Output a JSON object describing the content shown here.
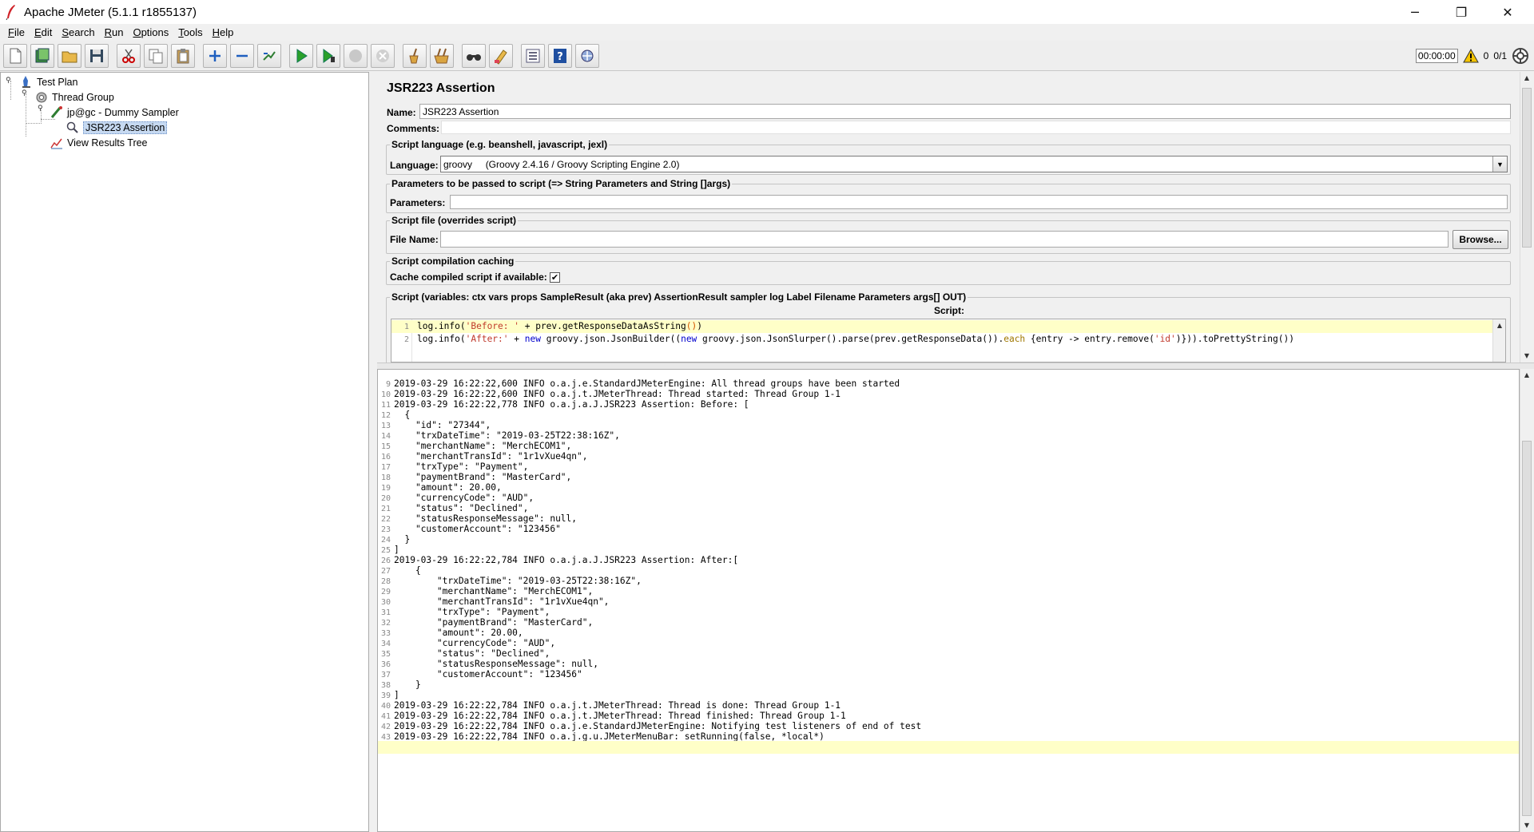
{
  "window": {
    "title": "Apache JMeter (5.1.1 r1855137)",
    "controls": {
      "minimize": "─",
      "maximize": "❐",
      "close": "✕"
    }
  },
  "menu": [
    "File",
    "Edit",
    "Search",
    "Run",
    "Options",
    "Tools",
    "Help"
  ],
  "toolbar": {
    "buttons": [
      "new-icon",
      "templates-icon",
      "open-icon",
      "save-icon",
      "cut-icon",
      "copy-icon",
      "paste-icon",
      "expand-icon",
      "collapse-icon",
      "toggle-icon",
      "start-icon",
      "start-no-pause-icon",
      "stop-icon",
      "shutdown-icon",
      "clear-icon",
      "clear-all-icon",
      "search-icon",
      "reset-search-icon",
      "function-helper-icon",
      "help-icon",
      "remote-icon"
    ],
    "timer": "00:00:00",
    "warning_count": "0",
    "threads": "0/1"
  },
  "tree": {
    "items": [
      {
        "label": "Test Plan",
        "icon": "test-plan-icon"
      },
      {
        "label": "Thread Group",
        "icon": "thread-group-icon"
      },
      {
        "label": "jp@gc - Dummy Sampler",
        "icon": "sampler-icon"
      },
      {
        "label": "JSR223 Assertion",
        "icon": "assertion-icon"
      },
      {
        "label": "View Results Tree",
        "icon": "listener-icon"
      }
    ]
  },
  "form": {
    "title": "JSR223 Assertion",
    "name_label": "Name:",
    "name_value": "JSR223 Assertion",
    "comments_label": "Comments:",
    "comments_value": "",
    "script_language_legend": "Script language (e.g. beanshell, javascript, jexl)",
    "language_label": "Language:",
    "language_value": "groovy     (Groovy 2.4.16 / Groovy Scripting Engine 2.0)",
    "parameters_legend": "Parameters to be passed to script (=> String Parameters and String []args)",
    "parameters_label": "Parameters:",
    "parameters_value": "",
    "script_file_legend": "Script file (overrides script)",
    "file_name_label": "File Name:",
    "file_name_value": "",
    "browse_label": "Browse...",
    "caching_legend": "Script compilation caching",
    "cache_label": "Cache compiled script if available:",
    "cache_checked": "✔",
    "script_legend": "Script (variables: ctx vars props SampleResult (aka prev) AssertionResult sampler log Label Filename Parameters args[] OUT)",
    "script_label": "Script:"
  },
  "script_lines": [
    {
      "n": "1",
      "a": "log.info(",
      "s": "'Before: '",
      "b": " + prev.getResponseDataAsString",
      "p": "()",
      "c": ")"
    },
    {
      "n": "2"
    }
  ],
  "script_line2": {
    "a": "log.info(",
    "s1": "'After:'",
    "b": " + ",
    "kw1": "new",
    "c": " groovy.json.JsonBuilder((",
    "kw2": "new",
    "d": " groovy.json.JsonSlurper().parse(prev.getResponseData()).",
    "each": "each",
    "e": " {entry -> entry.remove(",
    "s2": "'id'",
    "f": ")})).toPrettyString())"
  },
  "log": [
    {
      "n": "9",
      "t": "2019-03-29 16:22:22,600 INFO o.a.j.e.StandardJMeterEngine: All thread groups have been started"
    },
    {
      "n": "10",
      "t": "2019-03-29 16:22:22,600 INFO o.a.j.t.JMeterThread: Thread started: Thread Group 1-1"
    },
    {
      "n": "11",
      "t": "2019-03-29 16:22:22,778 INFO o.a.j.a.J.JSR223 Assertion: Before: ["
    },
    {
      "n": "12",
      "t": "  {"
    },
    {
      "n": "13",
      "t": "    \"id\": \"27344\","
    },
    {
      "n": "14",
      "t": "    \"trxDateTime\": \"2019-03-25T22:38:16Z\","
    },
    {
      "n": "15",
      "t": "    \"merchantName\": \"MerchECOM1\","
    },
    {
      "n": "16",
      "t": "    \"merchantTransId\": \"1r1vXue4qn\","
    },
    {
      "n": "17",
      "t": "    \"trxType\": \"Payment\","
    },
    {
      "n": "18",
      "t": "    \"paymentBrand\": \"MasterCard\","
    },
    {
      "n": "19",
      "t": "    \"amount\": 20.00,"
    },
    {
      "n": "20",
      "t": "    \"currencyCode\": \"AUD\","
    },
    {
      "n": "21",
      "t": "    \"status\": \"Declined\","
    },
    {
      "n": "22",
      "t": "    \"statusResponseMessage\": null,"
    },
    {
      "n": "23",
      "t": "    \"customerAccount\": \"123456\""
    },
    {
      "n": "24",
      "t": "  }"
    },
    {
      "n": "25",
      "t": "]"
    },
    {
      "n": "26",
      "t": "2019-03-29 16:22:22,784 INFO o.a.j.a.J.JSR223 Assertion: After:["
    },
    {
      "n": "27",
      "t": "    {"
    },
    {
      "n": "28",
      "t": "        \"trxDateTime\": \"2019-03-25T22:38:16Z\","
    },
    {
      "n": "29",
      "t": "        \"merchantName\": \"MerchECOM1\","
    },
    {
      "n": "30",
      "t": "        \"merchantTransId\": \"1r1vXue4qn\","
    },
    {
      "n": "31",
      "t": "        \"trxType\": \"Payment\","
    },
    {
      "n": "32",
      "t": "        \"paymentBrand\": \"MasterCard\","
    },
    {
      "n": "33",
      "t": "        \"amount\": 20.00,"
    },
    {
      "n": "34",
      "t": "        \"currencyCode\": \"AUD\","
    },
    {
      "n": "35",
      "t": "        \"status\": \"Declined\","
    },
    {
      "n": "36",
      "t": "        \"statusResponseMessage\": null,"
    },
    {
      "n": "37",
      "t": "        \"customerAccount\": \"123456\""
    },
    {
      "n": "38",
      "t": "    }"
    },
    {
      "n": "39",
      "t": "]"
    },
    {
      "n": "40",
      "t": "2019-03-29 16:22:22,784 INFO o.a.j.t.JMeterThread: Thread is done: Thread Group 1-1"
    },
    {
      "n": "41",
      "t": "2019-03-29 16:22:22,784 INFO o.a.j.t.JMeterThread: Thread finished: Thread Group 1-1"
    },
    {
      "n": "42",
      "t": "2019-03-29 16:22:22,784 INFO o.a.j.e.StandardJMeterEngine: Notifying test listeners of end of test"
    },
    {
      "n": "43",
      "t": "2019-03-29 16:22:22,784 INFO o.a.j.g.u.JMeterMenuBar: setRunning(false, *local*)"
    }
  ],
  "colors": {
    "selection": "#c6d9f1",
    "highlight_line": "#ffffc8",
    "keyword": "#0000cc",
    "string": "#c0392b"
  }
}
